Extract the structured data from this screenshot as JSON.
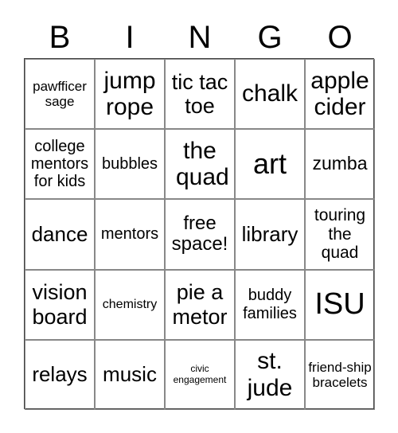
{
  "header": [
    "B",
    "I",
    "N",
    "G",
    "O"
  ],
  "cells": [
    [
      "pawfficer sage",
      "jump rope",
      "tic tac toe",
      "chalk",
      "apple cider"
    ],
    [
      "college mentors for kids",
      "bubbles",
      "the quad",
      "art",
      "zumba"
    ],
    [
      "dance",
      "mentors",
      "free space!",
      "library",
      "touring the quad"
    ],
    [
      "vision board",
      "chemistry",
      "pie a metor",
      "buddy families",
      "ISU"
    ],
    [
      "relays",
      "music",
      "civic engagement",
      "st. jude",
      "friend-ship bracelets"
    ]
  ]
}
